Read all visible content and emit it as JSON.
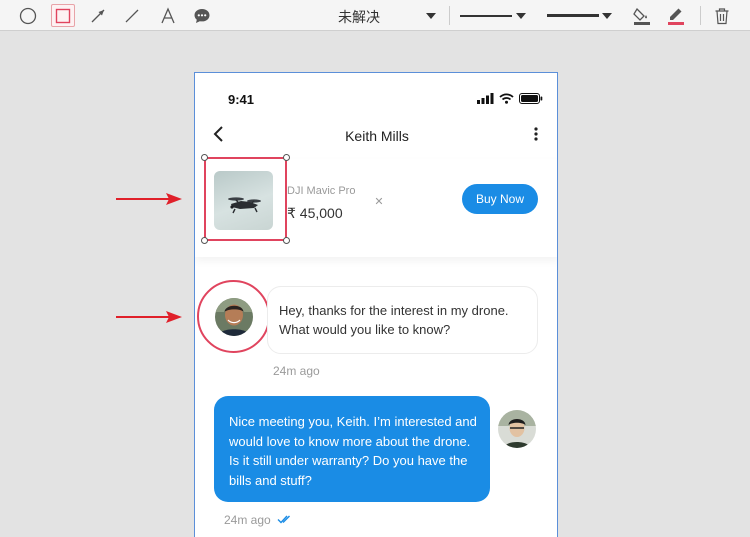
{
  "toolbar": {
    "tools": [
      "ellipse-tool",
      "rectangle-tool",
      "arrow-tool",
      "line-tool",
      "text-tool",
      "comment-tool"
    ],
    "status_value": "未解决",
    "line_style": "solid",
    "line_width": "medium",
    "fill_color": "#555555",
    "stroke_color": "#e0445e"
  },
  "annotation": {
    "color": "#e0445e",
    "arrow_color": "#e0202a"
  },
  "phone": {
    "status_bar": {
      "time": "9:41"
    },
    "header": {
      "contact_name": "Keith Mills"
    },
    "product": {
      "name": "DJI Mavic Pro",
      "price": "₹ 45,000",
      "close_glyph": "✕",
      "buy_label": "Buy Now"
    },
    "messages": [
      {
        "direction": "incoming",
        "text": "Hey, thanks for the interest in my drone. What would you like to know?",
        "time": "24m ago"
      },
      {
        "direction": "outgoing",
        "text": "Nice meeting you, Keith. I’m interested and would love to know more about the drone. Is it still under warranty? Do you have the bills and stuff?",
        "time": "24m ago",
        "status_icon": "double-check-icon"
      }
    ],
    "accent": "#1a8ce5"
  }
}
